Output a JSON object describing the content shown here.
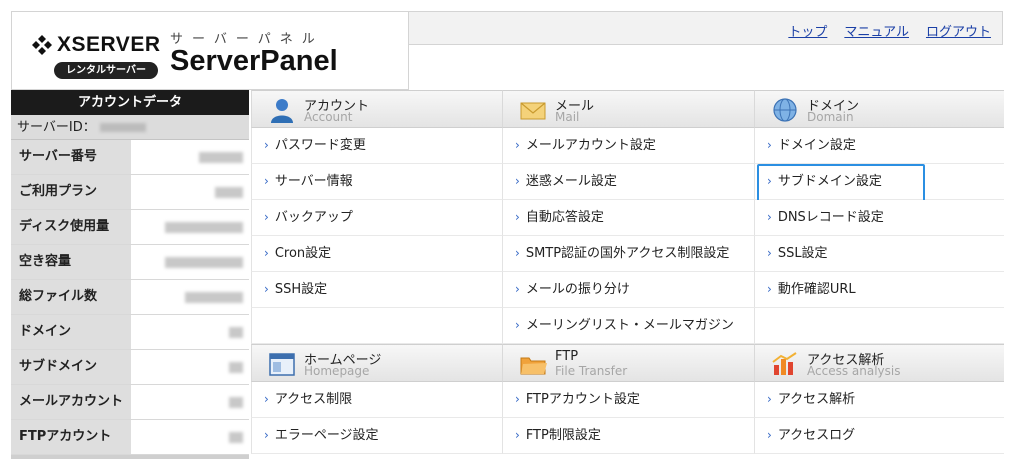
{
  "header": {
    "brand": "XSERVER",
    "brand_tag": "レンタルサーバー",
    "panel_kana": "サーバーパネル",
    "panel_title": "ServerPanel",
    "links": [
      "トップ",
      "マニュアル",
      "ログアウト"
    ]
  },
  "sidebar": {
    "title": "アカウントデータ",
    "id_label": "サーバーID：",
    "rows": [
      {
        "label": "サーバー番号"
      },
      {
        "label": "ご利用プラン"
      },
      {
        "label": "ディスク使用量"
      },
      {
        "label": "空き容量"
      },
      {
        "label": "総ファイル数"
      },
      {
        "label": "ドメイン"
      },
      {
        "label": "サブドメイン"
      },
      {
        "label": "メールアカウント"
      },
      {
        "label": "FTPアカウント"
      }
    ]
  },
  "menu": {
    "account": {
      "title": "アカウント",
      "subtitle": "Account",
      "icon": "user-icon",
      "items": [
        "パスワード変更",
        "サーバー情報",
        "バックアップ",
        "Cron設定",
        "SSH設定"
      ]
    },
    "mail": {
      "title": "メール",
      "subtitle": "Mail",
      "icon": "envelope-icon",
      "items": [
        "メールアカウント設定",
        "迷惑メール設定",
        "自動応答設定",
        "SMTP認証の国外アクセス制限設定",
        "メールの振り分け",
        "メーリングリスト・メールマガジン"
      ]
    },
    "domain": {
      "title": "ドメイン",
      "subtitle": "Domain",
      "icon": "globe-icon",
      "items": [
        "ドメイン設定",
        "サブドメイン設定",
        "DNSレコード設定",
        "SSL設定",
        "動作確認URL"
      ]
    },
    "homepage": {
      "title": "ホームページ",
      "subtitle": "Homepage",
      "icon": "window-icon",
      "items": [
        "アクセス制限",
        "エラーページ設定"
      ]
    },
    "ftp": {
      "title": "FTP",
      "subtitle": "File Transfer",
      "icon": "folder-icon",
      "items": [
        "FTPアカウント設定",
        "FTP制限設定"
      ]
    },
    "analytics": {
      "title": "アクセス解析",
      "subtitle": "Access analysis",
      "icon": "bar-chart-icon",
      "items": [
        "アクセス解析",
        "アクセスログ"
      ]
    }
  }
}
